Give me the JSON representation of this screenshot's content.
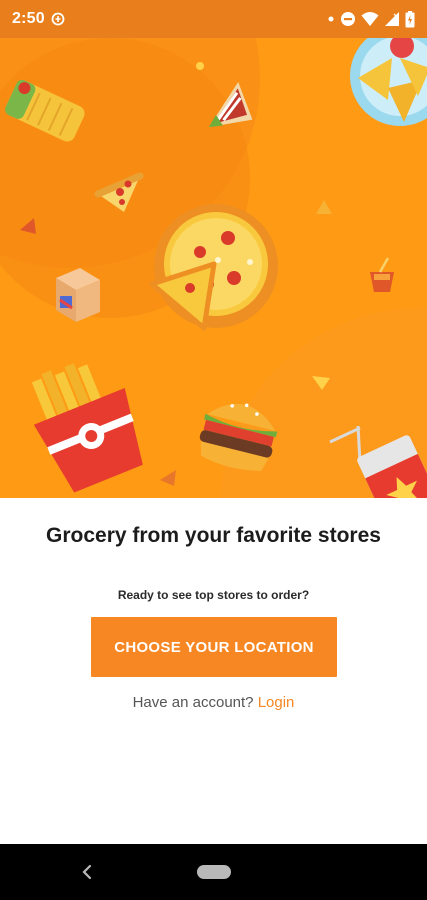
{
  "status_bar": {
    "time": "2:50",
    "icons": [
      "data-saver-icon",
      "notification-dot-icon",
      "do-not-disturb-icon",
      "wifi-icon",
      "signal-icon",
      "battery-icon"
    ]
  },
  "hero": {
    "background_color": "#ff9a14",
    "illustrations": [
      "burrito-icon",
      "pizza-slice-icon",
      "sandwich-icon",
      "pizza-icon",
      "nachos-icon",
      "gift-box-icon",
      "drink-cup-icon",
      "fries-icon",
      "burger-icon",
      "soda-can-icon"
    ]
  },
  "onboarding": {
    "headline": "Grocery from your favorite stores",
    "subtitle": "Ready to see top stores to order?",
    "cta_label": "CHOOSE YOUR LOCATION",
    "account_prompt": "Have an account?",
    "login_label": "Login"
  },
  "colors": {
    "status_bar": "#e87f1c",
    "accent": "#f68723",
    "hero": "#ff9a14"
  },
  "nav_bar": {
    "back_icon": "back-chevron-icon",
    "home_icon": "home-pill-icon"
  }
}
